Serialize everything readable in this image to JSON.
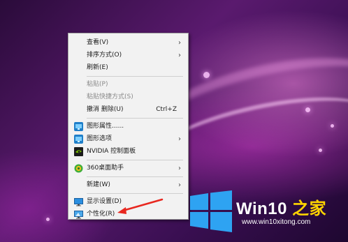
{
  "context_menu": {
    "items": [
      {
        "label": "查看(V)",
        "has_submenu": true
      },
      {
        "label": "排序方式(O)",
        "has_submenu": true
      },
      {
        "label": "刷新(E)"
      },
      {
        "label": "粘贴(P)",
        "disabled": true
      },
      {
        "label": "粘贴快捷方式(S)",
        "disabled": true
      },
      {
        "label": "撤消 删除(U)",
        "shortcut": "Ctrl+Z"
      },
      {
        "label": "图形属性......",
        "icon": "intel-graphics-icon"
      },
      {
        "label": "图形选项",
        "icon": "intel-graphics-icon",
        "has_submenu": true
      },
      {
        "label": "NVIDIA 控制面板",
        "icon": "nvidia-icon"
      },
      {
        "label": "360桌面助手",
        "icon": "360-desktop-icon",
        "has_submenu": true
      },
      {
        "label": "新建(W)",
        "has_submenu": true
      },
      {
        "label": "显示设置(D)",
        "icon": "display-icon"
      },
      {
        "label": "个性化(R)",
        "icon": "personalize-icon"
      }
    ],
    "submenu_arrow": "›"
  },
  "watermark": {
    "brand_main": "Win10",
    "brand_suffix": " 之家",
    "site": "www.win10xitong.com"
  },
  "colors": {
    "menu_bg": "#f2f2f2",
    "annotation_arrow": "#e8271f",
    "brand_suffix": "#ffd400",
    "windows_logo": "#2ea3f2"
  }
}
